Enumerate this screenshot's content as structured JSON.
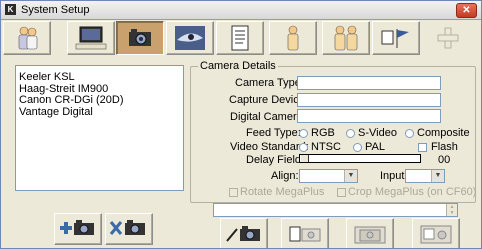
{
  "window": {
    "title": "System Setup"
  },
  "toolbar": {
    "buttons": [
      {
        "name": "users-icon",
        "active": false
      },
      {
        "name": "computer-icon",
        "active": false
      },
      {
        "name": "camera-icon",
        "active": true
      },
      {
        "name": "eye-icon",
        "active": false
      },
      {
        "name": "document-icon",
        "active": false
      },
      {
        "name": "person-icon",
        "active": false
      },
      {
        "name": "people-icon",
        "active": false
      },
      {
        "name": "flags-icon",
        "active": false
      },
      {
        "name": "plus-icon",
        "active": false,
        "disabled": true
      }
    ]
  },
  "camera_list": {
    "items": [
      "Keeler KSL",
      "Haag-Streit IM900",
      "Canon CR-DGi (20D)",
      "Vantage Digital"
    ]
  },
  "camera_details": {
    "title": "Camera Details",
    "camera_type_label": "Camera Type:",
    "camera_type_value": "",
    "capture_device_label": "Capture Device:",
    "capture_device_value": "",
    "digital_camera_label": "Digital Camera:",
    "digital_camera_value": "",
    "feed_type_label": "Feed Type:",
    "feed_options": [
      "RGB",
      "S-Video",
      "Composite"
    ],
    "video_standard_label": "Video Standard:",
    "video_options": [
      "NTSC",
      "PAL"
    ],
    "flash_label": "Flash",
    "delay_label": "Delay Field:",
    "delay_value": "00",
    "delay_level": 0,
    "align_label": "Align:",
    "align_value": "",
    "input_label": "Input:",
    "input_value": "",
    "rotate_label": "Rotate MegaPlus",
    "crop_label": "Crop MegaPlus (on CF60)"
  },
  "colors": {
    "window_bg": "#ece9d8",
    "active_tab": "#c9a16c",
    "field_border": "#7f9db9",
    "close_red": "#c23b22"
  }
}
